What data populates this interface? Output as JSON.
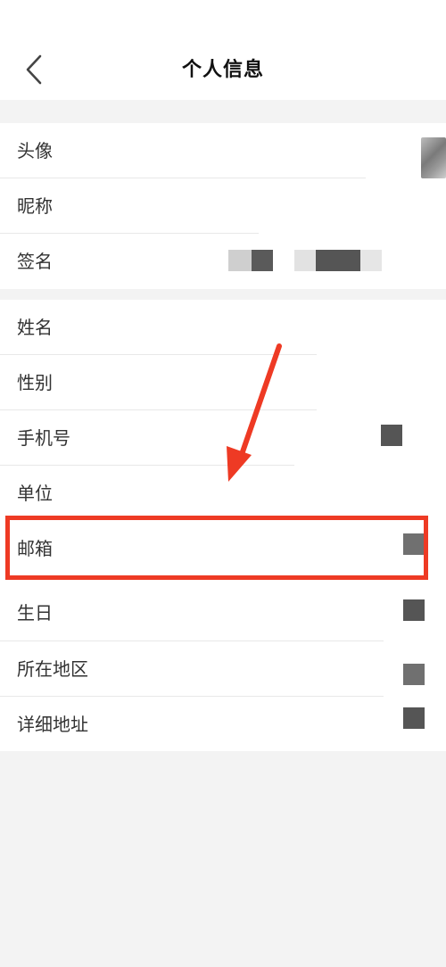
{
  "header": {
    "title": "个人信息",
    "back_icon": "chevron-left-icon"
  },
  "group1": {
    "rows": [
      {
        "label": "头像"
      },
      {
        "label": "昵称"
      },
      {
        "label": "签名"
      }
    ]
  },
  "group2": {
    "rows": [
      {
        "label": "姓名"
      },
      {
        "label": "性别"
      },
      {
        "label": "手机号"
      },
      {
        "label": "单位"
      },
      {
        "label": "邮箱"
      },
      {
        "label": "生日"
      },
      {
        "label": "所在地区"
      },
      {
        "label": "详细地址"
      }
    ]
  },
  "annotation": {
    "highlight_color": "#ee3a24",
    "highlighted_row": "邮箱"
  },
  "colors": {
    "background": "#f3f3f3",
    "card": "#ffffff",
    "divider": "#e8e8e8",
    "label": "#333333"
  }
}
